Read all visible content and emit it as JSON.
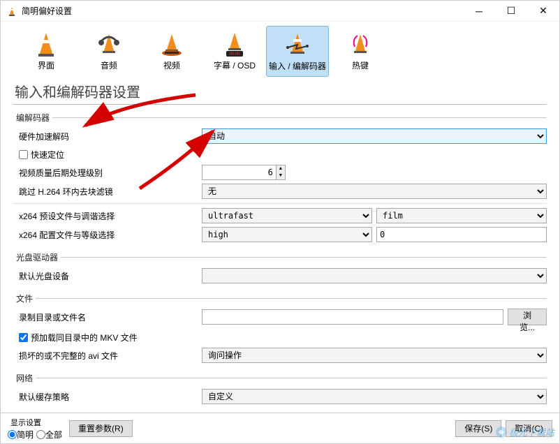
{
  "window": {
    "title": "简明偏好设置"
  },
  "toolbar": {
    "items": [
      {
        "label": "界面"
      },
      {
        "label": "音频"
      },
      {
        "label": "视频"
      },
      {
        "label": "字幕 / OSD"
      },
      {
        "label": "输入 / 编解码器"
      },
      {
        "label": "热键"
      }
    ]
  },
  "section_title": "输入和编解码器设置",
  "codecs": {
    "legend": "编解码器",
    "hw_decode_label": "硬件加速解码",
    "hw_decode_value": "自动",
    "fast_seek_label": "快速定位",
    "fast_seek_checked": false,
    "postproc_label": "视频质量后期处理级别",
    "postproc_value": "6",
    "skip_loop_label": "跳过 H.264 环内去块滤镜",
    "skip_loop_value": "无",
    "x264_preset_label": "x264 预设文件与调谐选择",
    "x264_preset_value": "ultrafast",
    "x264_tune_value": "film",
    "x264_profile_label": "x264 配置文件与等级选择",
    "x264_profile_value": "high",
    "x264_level_value": "0"
  },
  "optical": {
    "legend": "光盘驱动器",
    "default_device_label": "默认光盘设备",
    "default_device_value": ""
  },
  "files": {
    "legend": "文件",
    "record_dir_label": "录制目录或文件名",
    "record_dir_value": "",
    "browse_label": "浏览...",
    "preload_mkv_label": "预加载同目录中的 MKV 文件",
    "preload_mkv_checked": true,
    "damaged_avi_label": "损坏的或不完整的 avi 文件",
    "damaged_avi_value": "询问操作"
  },
  "network": {
    "legend": "网络",
    "cache_policy_label": "默认缓存策略",
    "cache_policy_value": "自定义"
  },
  "footer": {
    "show_settings_label": "显示设置",
    "simple_label": "简明",
    "all_label": "全部",
    "reset_label": "重置参数(R)",
    "save_label": "保存(S)",
    "cancel_label": "取消(C)"
  },
  "watermark": "极光下载站"
}
